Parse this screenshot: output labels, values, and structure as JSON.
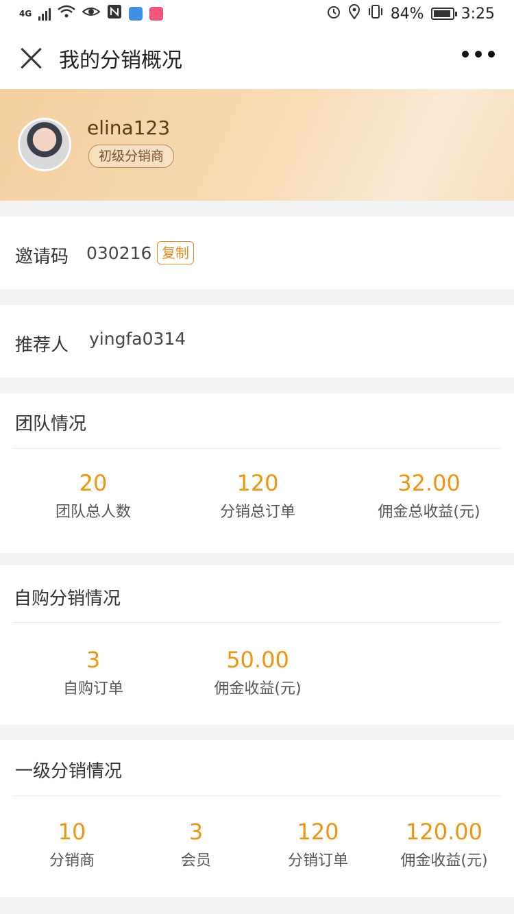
{
  "status_bar": {
    "network": "4G",
    "battery": "84%",
    "time": "3:25"
  },
  "nav": {
    "title": "我的分销概况"
  },
  "profile": {
    "username": "elina123",
    "level": "初级分销商"
  },
  "invite": {
    "label": "邀请码",
    "code": "030216",
    "copy_label": "复制"
  },
  "referrer": {
    "label": "推荐人",
    "value": "yingfa0314"
  },
  "team": {
    "title": "团队情况",
    "stats": [
      {
        "value": "20",
        "label": "团队总人数"
      },
      {
        "value": "120",
        "label": "分销总订单"
      },
      {
        "value": "32.00",
        "label": "佣金总收益(元)"
      }
    ]
  },
  "self_purchase": {
    "title": "自购分销情况",
    "stats": [
      {
        "value": "3",
        "label": "自购订单"
      },
      {
        "value": "50.00",
        "label": "佣金收益(元)"
      }
    ]
  },
  "level1": {
    "title": "一级分销情况",
    "stats": [
      {
        "value": "10",
        "label": "分销商"
      },
      {
        "value": "3",
        "label": "会员"
      },
      {
        "value": "120",
        "label": "分销订单"
      },
      {
        "value": "120.00",
        "label": "佣金收益(元)"
      }
    ]
  },
  "colors": {
    "accent": "#f0930f",
    "copy_border": "#e88a1a",
    "profile_bg": "#f5cf9f"
  }
}
